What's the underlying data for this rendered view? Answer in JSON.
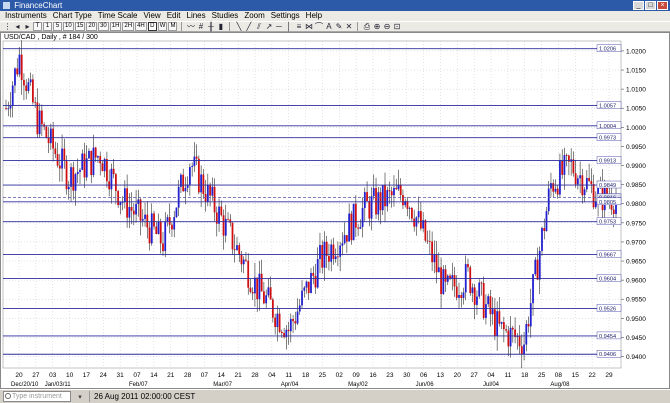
{
  "window": {
    "title": "FinanceChart",
    "controls": [
      "_",
      "□",
      "×"
    ]
  },
  "menu": [
    "Instruments",
    "Chart Type",
    "Time Scale",
    "View",
    "Edit",
    "Lines",
    "Studies",
    "Zoom",
    "Settings",
    "Help"
  ],
  "toolbar": {
    "timescale": [
      "T",
      "1",
      "5",
      "10",
      "15",
      "20",
      "30",
      "1H",
      "2H",
      "4H",
      "D",
      "W",
      "M"
    ],
    "active_timescale": "D"
  },
  "chart": {
    "label": "USD/CAD , Daily , # 184 / 300",
    "price_axis_ticks": [
      "1.0200",
      "1.0150",
      "1.0100",
      "1.0050",
      "1.0000",
      "0.9950",
      "0.9900",
      "0.9850",
      "0.9800",
      "0.9750",
      "0.9700",
      "0.9650",
      "0.9600",
      "0.9550",
      "0.9500",
      "0.9450",
      "0.9400"
    ],
    "level_labels": [
      "1.0206",
      "1.0057",
      "1.0004",
      "0.9973",
      "0.9913",
      "0.9849",
      "0.9816",
      "0.9805",
      "0.9753",
      "0.9667",
      "0.9604",
      "0.9526",
      "0.9454",
      "0.9406"
    ],
    "x_day_labels": [
      "20",
      "27",
      "03",
      "10",
      "17",
      "24",
      "31",
      "07",
      "14",
      "21",
      "28",
      "07",
      "14",
      "21",
      "28",
      "04",
      "11",
      "18",
      "25",
      "02",
      "09",
      "16",
      "23",
      "30",
      "06",
      "13",
      "20",
      "27",
      "04",
      "11",
      "18",
      "25",
      "08",
      "15",
      "22",
      "29"
    ],
    "x_month_labels": [
      "Dec/20/10",
      "Jan/03/11",
      "Feb/07",
      "Mar/07",
      "Apr/04",
      "May/02",
      "Jun/06",
      "Jul/04",
      "Aug/08"
    ]
  },
  "chart_data": {
    "type": "candlestick",
    "title": "USD/CAD , Daily , # 184 / 300",
    "ylim": [
      0.937,
      1.0226
    ],
    "horizontal_levels": [
      1.0206,
      1.0057,
      1.0004,
      0.9973,
      0.9913,
      0.9849,
      0.9805,
      0.9753,
      0.9667,
      0.9604,
      0.9526,
      0.9454,
      0.9406
    ],
    "current_price": 0.9816,
    "colors": {
      "up": "#2020d0",
      "down": "#d01010",
      "level": "#2c2c9c",
      "grid": "#b8b8c8"
    }
  },
  "status": {
    "search_placeholder": "Type instrument name",
    "datetime": "26 Aug 2011 02:00:00 CEST"
  }
}
